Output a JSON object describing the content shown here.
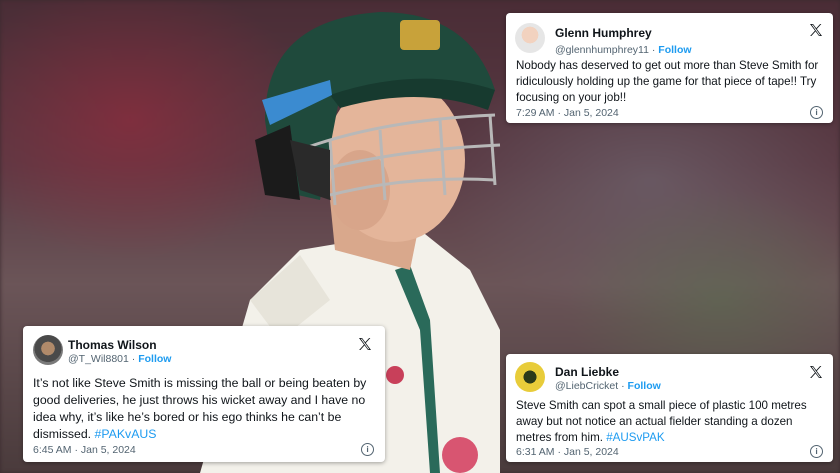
{
  "tweets": {
    "glenn": {
      "name": "Glenn Humphrey",
      "handle": "@glennhumphrey11",
      "separator": "·",
      "follow": "Follow",
      "text": "Nobody has deserved to get out more than Steve Smith for ridiculously holding up the game for that piece of tape!! Try focusing on your job!!",
      "timestamp": "7:29 AM · Jan 5, 2024"
    },
    "thomas": {
      "name": "Thomas Wilson",
      "handle": "@T_Wil8801",
      "separator": "·",
      "follow": "Follow",
      "text": "It’s not like Steve Smith is missing the ball or being beaten by good deliveries, he just throws his wicket away and I have no idea why, it’s like he’s bored or his ego thinks he can’t be dismissed.",
      "hashtag": "#PAKvAUS",
      "timestamp": "6:45 AM · Jan 5, 2024"
    },
    "dan": {
      "name": "Dan Liebke",
      "handle": "@LiebCricket",
      "separator": "·",
      "follow": "Follow",
      "text": "Steve Smith can spot a small piece of plastic 100 metres away but not notice an actual fielder standing a dozen metres from him.",
      "hashtag": "#AUSvPAK",
      "timestamp": "6:31 AM · Jan 5, 2024"
    }
  },
  "icons": {
    "x_logo": "x-logo-icon",
    "info": "info-icon",
    "info_glyph": "i"
  },
  "colors": {
    "link": "#1d9bf0",
    "helmet": "#1f4a3c",
    "shirt": "#f3f1ea"
  }
}
